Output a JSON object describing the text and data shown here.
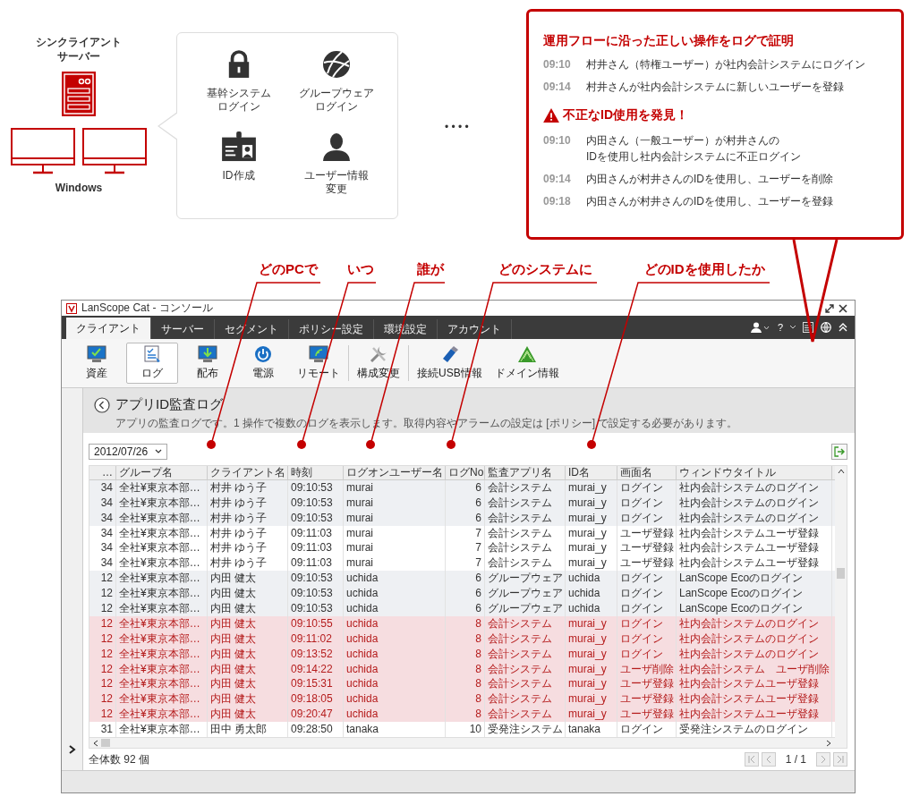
{
  "client": {
    "server_label": [
      "シンクライアント",
      "サーバー"
    ],
    "os_label": "Windows"
  },
  "operations": [
    {
      "kind": "lock",
      "label": [
        "基幹システム",
        "ログイン"
      ]
    },
    {
      "kind": "globe",
      "label": [
        "グループウェア",
        "ログイン"
      ]
    },
    {
      "kind": "badge",
      "label": [
        "ID作成"
      ]
    },
    {
      "kind": "person",
      "label": [
        "ユーザー情報",
        "変更"
      ]
    }
  ],
  "ellipsis": "• • • •",
  "callout": {
    "title": "運用フローに沿った正しい操作をログで証明",
    "normal": [
      {
        "time": "09:10",
        "text": "村井さん（特権ユーザー）が社内会計システムにログイン"
      },
      {
        "time": "09:14",
        "text": "村井さんが社内会計システムに新しいユーザーを登録"
      }
    ],
    "alert_title": "不正なID使用を発見！",
    "alerts": [
      {
        "time": "09:10",
        "text": "内田さん（一般ユーザー）が村井さんの\nIDを使用し社内会計システムに不正ログイン"
      },
      {
        "time": "09:14",
        "text": "内田さんが村井さんのIDを使用し、ユーザーを削除"
      },
      {
        "time": "09:18",
        "text": "内田さんが村井さんのIDを使用し、ユーザーを登録"
      }
    ]
  },
  "annotations": [
    {
      "label": "どのPCで"
    },
    {
      "label": "いつ"
    },
    {
      "label": "誰が"
    },
    {
      "label": "どのシステムに"
    },
    {
      "label": "どのIDを使用したか"
    }
  ],
  "window": {
    "title": "LanScope Cat - コンソール",
    "tabs": [
      {
        "label": "クライアント",
        "selected": true
      },
      {
        "label": "サーバー",
        "selected": false
      },
      {
        "label": "セグメント",
        "selected": false
      },
      {
        "label": "ポリシー設定",
        "selected": false
      },
      {
        "label": "環境設定",
        "selected": false
      },
      {
        "label": "アカウント",
        "selected": false
      }
    ],
    "help_label": "?",
    "toolbar": [
      {
        "kind": "asset",
        "label": "資産",
        "selected": false
      },
      {
        "kind": "log",
        "label": "ログ",
        "selected": true
      },
      {
        "kind": "deploy",
        "label": "配布",
        "selected": false
      },
      {
        "kind": "power",
        "label": "電源",
        "selected": false
      },
      {
        "kind": "remote",
        "label": "リモート",
        "selected": false
      },
      {
        "kind": "tools",
        "label": "構成変更",
        "selected": false
      },
      {
        "kind": "usb",
        "label": "接続USB情報",
        "selected": false
      },
      {
        "kind": "domain",
        "label": "ドメイン情報",
        "selected": false
      }
    ],
    "page_title": "アプリID監査ログ",
    "description": "アプリの監査ログです。1 操作で複数のログを表示します。取得内容やアラームの設定は [ポリシー] で設定する必要があります。",
    "date": "2012/07/26",
    "columns": [
      "…",
      "グループ名",
      "クライアント名",
      "時刻",
      "ログオンユーザー名",
      "ログNo",
      "監査アプリ名",
      "ID名",
      "画面名",
      "ウィンドウタイトル"
    ],
    "rows": [
      {
        "kind": "shaded",
        "cells": [
          "34",
          "全社¥東京本部…",
          "村井 ゆう子",
          "09:10:53",
          "murai",
          "6",
          "会計システム",
          "murai_y",
          "ログイン",
          "社内会計システムのログイン"
        ]
      },
      {
        "kind": "shaded",
        "cells": [
          "34",
          "全社¥東京本部…",
          "村井 ゆう子",
          "09:10:53",
          "murai",
          "6",
          "会計システム",
          "murai_y",
          "ログイン",
          "社内会計システムのログイン"
        ]
      },
      {
        "kind": "shaded",
        "cells": [
          "34",
          "全社¥東京本部…",
          "村井 ゆう子",
          "09:10:53",
          "murai",
          "6",
          "会計システム",
          "murai_y",
          "ログイン",
          "社内会計システムのログイン"
        ]
      },
      {
        "kind": "plain",
        "cells": [
          "34",
          "全社¥東京本部…",
          "村井 ゆう子",
          "09:11:03",
          "murai",
          "7",
          "会計システム",
          "murai_y",
          "ユーザ登録",
          "社内会計システムユーザ登録"
        ]
      },
      {
        "kind": "plain",
        "cells": [
          "34",
          "全社¥東京本部…",
          "村井 ゆう子",
          "09:11:03",
          "murai",
          "7",
          "会計システム",
          "murai_y",
          "ユーザ登録",
          "社内会計システムユーザ登録"
        ]
      },
      {
        "kind": "plain",
        "cells": [
          "34",
          "全社¥東京本部…",
          "村井 ゆう子",
          "09:11:03",
          "murai",
          "7",
          "会計システム",
          "murai_y",
          "ユーザ登録",
          "社内会計システムユーザ登録"
        ]
      },
      {
        "kind": "shaded",
        "cells": [
          "12",
          "全社¥東京本部…",
          "内田 健太",
          "09:10:53",
          "uchida",
          "6",
          "グループウェア",
          "uchida",
          "ログイン",
          "LanScope Ecoのログイン"
        ]
      },
      {
        "kind": "shaded",
        "cells": [
          "12",
          "全社¥東京本部…",
          "内田 健太",
          "09:10:53",
          "uchida",
          "6",
          "グループウェア",
          "uchida",
          "ログイン",
          "LanScope Ecoのログイン"
        ]
      },
      {
        "kind": "shaded",
        "cells": [
          "12",
          "全社¥東京本部…",
          "内田 健太",
          "09:10:53",
          "uchida",
          "6",
          "グループウェア",
          "uchida",
          "ログイン",
          "LanScope Ecoのログイン"
        ]
      },
      {
        "kind": "alert",
        "cells": [
          "12",
          "全社¥東京本部…",
          "内田 健太",
          "09:10:55",
          "uchida",
          "8",
          "会計システム",
          "murai_y",
          "ログイン",
          "社内会計システムのログイン"
        ]
      },
      {
        "kind": "alert",
        "cells": [
          "12",
          "全社¥東京本部…",
          "内田 健太",
          "09:11:02",
          "uchida",
          "8",
          "会計システム",
          "murai_y",
          "ログイン",
          "社内会計システムのログイン"
        ]
      },
      {
        "kind": "alert",
        "cells": [
          "12",
          "全社¥東京本部…",
          "内田 健太",
          "09:13:52",
          "uchida",
          "8",
          "会計システム",
          "murai_y",
          "ログイン",
          "社内会計システムのログイン"
        ]
      },
      {
        "kind": "alert",
        "cells": [
          "12",
          "全社¥東京本部…",
          "内田 健太",
          "09:14:22",
          "uchida",
          "8",
          "会計システム",
          "murai_y",
          "ユーザ削除",
          "社内会計システム　ユーザ削除"
        ]
      },
      {
        "kind": "alert",
        "cells": [
          "12",
          "全社¥東京本部…",
          "内田 健太",
          "09:15:31",
          "uchida",
          "8",
          "会計システム",
          "murai_y",
          "ユーザ登録",
          "社内会計システムユーザ登録"
        ]
      },
      {
        "kind": "alert",
        "cells": [
          "12",
          "全社¥東京本部…",
          "内田 健太",
          "09:18:05",
          "uchida",
          "8",
          "会計システム",
          "murai_y",
          "ユーザ登録",
          "社内会計システムユーザ登録"
        ]
      },
      {
        "kind": "alert",
        "cells": [
          "12",
          "全社¥東京本部…",
          "内田 健太",
          "09:20:47",
          "uchida",
          "8",
          "会計システム",
          "murai_y",
          "ユーザ登録",
          "社内会計システムユーザ登録"
        ]
      },
      {
        "kind": "plain",
        "cells": [
          "31",
          "全社¥東京本部…",
          "田中 勇太郎",
          "09:28:50",
          "tanaka",
          "10",
          "受発注システム",
          "tanaka",
          "ログイン",
          "受発注システムのログイン"
        ]
      }
    ],
    "total": "全体数 92 個",
    "page": "1 / 1"
  }
}
